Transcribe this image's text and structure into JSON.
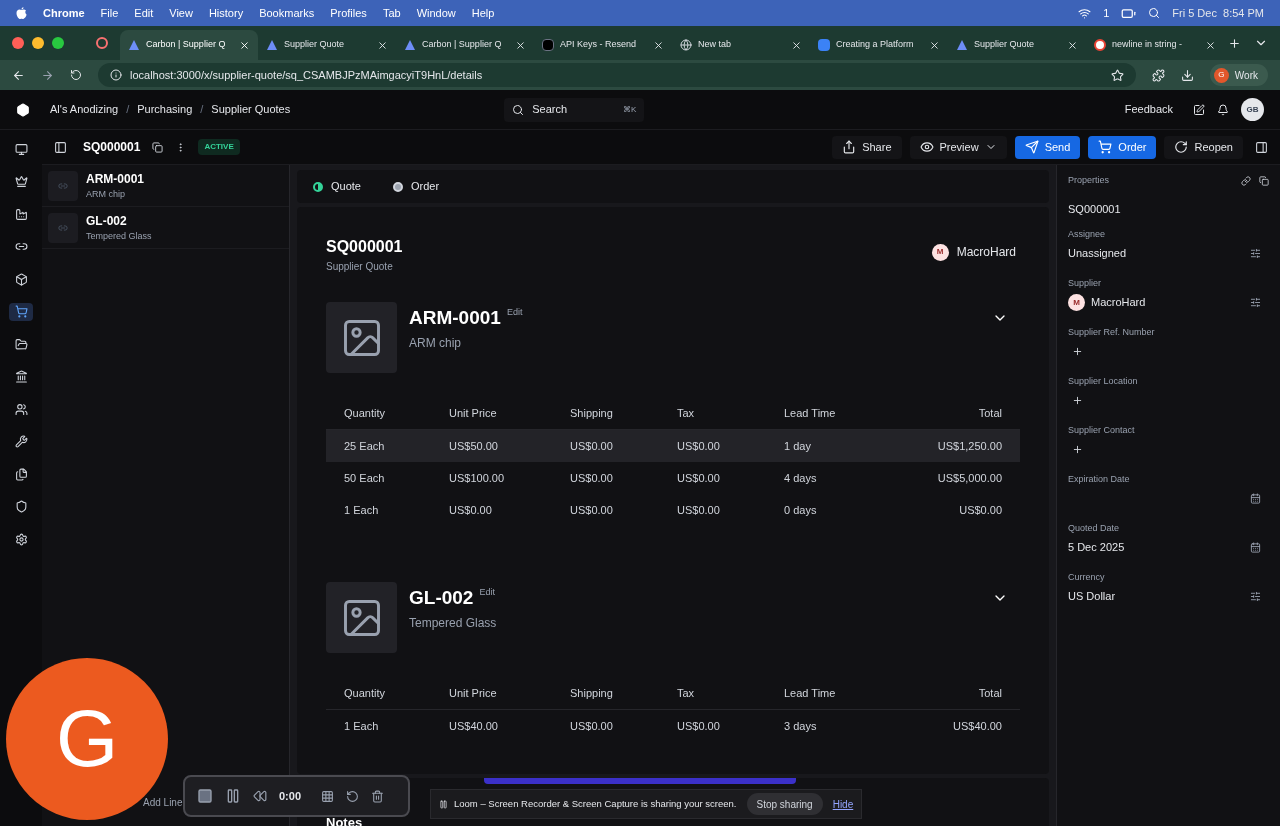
{
  "menu_bar": {
    "app": "Chrome",
    "items": [
      "File",
      "Edit",
      "View",
      "History",
      "Bookmarks",
      "Profiles",
      "Tab",
      "Window",
      "Help"
    ],
    "badge_count": "1",
    "clock": "Fri 5 Dec  8:54 PM"
  },
  "browser_tabs": [
    {
      "title": "Carbon | Supplier Q",
      "kind": "carbon",
      "selected": true
    },
    {
      "title": "Supplier Quote",
      "kind": "carbon",
      "selected": false
    },
    {
      "title": "Carbon | Supplier Q",
      "kind": "carbon",
      "selected": false
    },
    {
      "title": "API Keys - Resend",
      "kind": "resend",
      "selected": false
    },
    {
      "title": "New tab",
      "kind": "chrome",
      "selected": false
    },
    {
      "title": "Creating a Platform",
      "kind": "platform",
      "selected": false
    },
    {
      "title": "Supplier Quote",
      "kind": "carbon",
      "selected": false
    },
    {
      "title": "newline in string -",
      "kind": "google",
      "selected": false
    }
  ],
  "address_bar": {
    "url": "localhost:3000/x/supplier-quote/sq_CSAMBJPzMAimgacyiT9HnL/details",
    "profile_initial": "G",
    "profile": "Work"
  },
  "app_header": {
    "breadcrumbs": [
      "Al's Anodizing",
      "Purchasing",
      "Supplier Quotes"
    ],
    "breadcrumb_separator": "/",
    "search": {
      "placeholder": "Search",
      "shortcut": "⌘K"
    },
    "feedback": "Feedback",
    "user_initials": "GB"
  },
  "rail": [
    {
      "kind": "monitor",
      "selected": false
    },
    {
      "kind": "crown",
      "selected": false
    },
    {
      "kind": "factory",
      "selected": false
    },
    {
      "kind": "links",
      "selected": false
    },
    {
      "kind": "box",
      "selected": false
    },
    {
      "kind": "cart",
      "selected": true
    },
    {
      "kind": "folder",
      "selected": false
    },
    {
      "kind": "bank",
      "selected": false
    },
    {
      "kind": "users",
      "selected": false
    },
    {
      "kind": "wrench",
      "selected": false
    },
    {
      "kind": "files",
      "selected": false
    },
    {
      "kind": "shield",
      "selected": false
    },
    {
      "kind": "settings",
      "selected": false
    }
  ],
  "toolbar": {
    "title": "SQ000001",
    "status": "ACTIVE",
    "buttons": [
      {
        "label": "Share",
        "kind": "share"
      },
      {
        "label": "Preview",
        "kind": "preview"
      },
      {
        "label": "Send",
        "kind": "send"
      },
      {
        "label": "Order",
        "kind": "order"
      },
      {
        "label": "Reopen",
        "kind": "reopen"
      }
    ]
  },
  "line_list": {
    "items": [
      {
        "code": "ARM-0001",
        "name": "ARM chip"
      },
      {
        "code": "GL-002",
        "name": "Tempered Glass"
      }
    ],
    "add_line": "Add Line"
  },
  "view_tabs": [
    {
      "label": "Quote",
      "selected": true
    },
    {
      "label": "Order",
      "selected": false
    }
  ],
  "document": {
    "number": "SQ000001",
    "type": "Supplier Quote",
    "supplier_initial": "M",
    "supplier": "MacroHard",
    "items": [
      {
        "code": "ARM-0001",
        "edit": "Edit",
        "name": "ARM chip",
        "columns": [
          "Quantity",
          "Unit Price",
          "Shipping",
          "Tax",
          "Lead Time",
          "Total"
        ],
        "rows": [
          {
            "cells": [
              "25 Each",
              "US$50.00",
              "US$0.00",
              "US$0.00",
              "1 day",
              "US$1,250.00"
            ],
            "highlighted": true
          },
          {
            "cells": [
              "50 Each",
              "US$100.00",
              "US$0.00",
              "US$0.00",
              "4 days",
              "US$5,000.00"
            ],
            "highlighted": false
          },
          {
            "cells": [
              "1 Each",
              "US$0.00",
              "US$0.00",
              "US$0.00",
              "0 days",
              "US$0.00"
            ],
            "highlighted": false
          }
        ]
      },
      {
        "code": "GL-002",
        "edit": "Edit",
        "name": "Tempered Glass",
        "columns": [
          "Quantity",
          "Unit Price",
          "Shipping",
          "Tax",
          "Lead Time",
          "Total"
        ],
        "rows": [
          {
            "cells": [
              "1 Each",
              "US$40.00",
              "US$0.00",
              "US$0.00",
              "3 days",
              "US$40.00"
            ],
            "highlighted": false
          }
        ]
      }
    ],
    "notes_heading": "Notes"
  },
  "properties": {
    "title": "Properties",
    "id": "SQ000001",
    "fields": [
      {
        "label": "Assignee",
        "value": "Unassigned",
        "kind": "select"
      },
      {
        "label": "Supplier",
        "value": "MacroHard",
        "initial": "M",
        "kind": "select"
      },
      {
        "label": "Supplier Ref. Number",
        "kind": "add"
      },
      {
        "label": "Supplier Location",
        "kind": "add"
      },
      {
        "label": "Supplier Contact",
        "kind": "add"
      },
      {
        "label": "Expiration Date",
        "kind": "date"
      },
      {
        "label": "Quoted Date",
        "value": "5 Dec 2025",
        "kind": "date"
      },
      {
        "label": "Currency",
        "value": "US Dollar",
        "kind": "select"
      }
    ]
  },
  "camera_bubble": {
    "initial": "G"
  },
  "recorder": {
    "time": "0:00"
  },
  "share_banner": {
    "message": "Loom – Screen Recorder & Screen Capture is sharing your screen.",
    "stop": "Stop sharing",
    "hide": "Hide"
  }
}
